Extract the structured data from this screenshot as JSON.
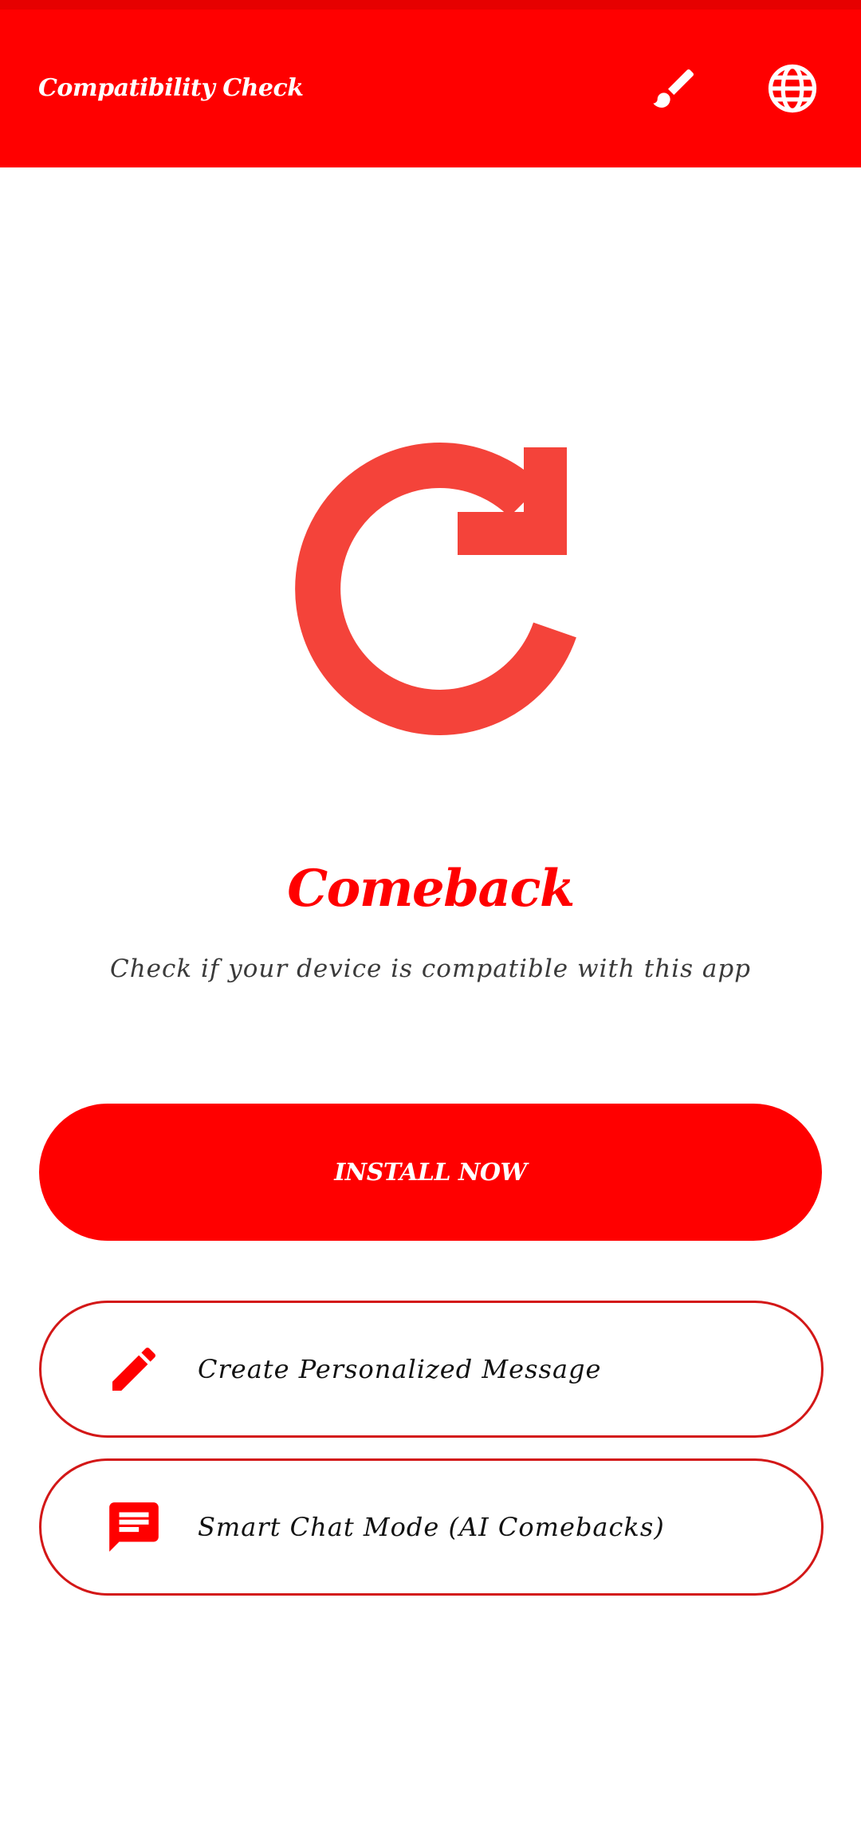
{
  "app_bar": {
    "title": "Compatibility Check",
    "icons": [
      "paint-brush-icon",
      "globe-icon"
    ]
  },
  "hero": {
    "logo_icon": "redo-arrow-icon",
    "app_name": "Comeback",
    "subtitle": "Check if your device is compatible with this app"
  },
  "actions": {
    "install_label": "INSTALL NOW",
    "options": [
      {
        "label": "Create Personalized Message",
        "icon": "pencil-icon"
      },
      {
        "label": "Smart Chat Mode (AI Comebacks)",
        "icon": "chat-message-icon"
      }
    ]
  },
  "colors": {
    "primary": "#ff0000",
    "status_bar": "#e60000",
    "logo": "#f4433a",
    "outline": "#d31717",
    "subtitle_text": "#3a3a3a",
    "background": "#ffffff"
  }
}
